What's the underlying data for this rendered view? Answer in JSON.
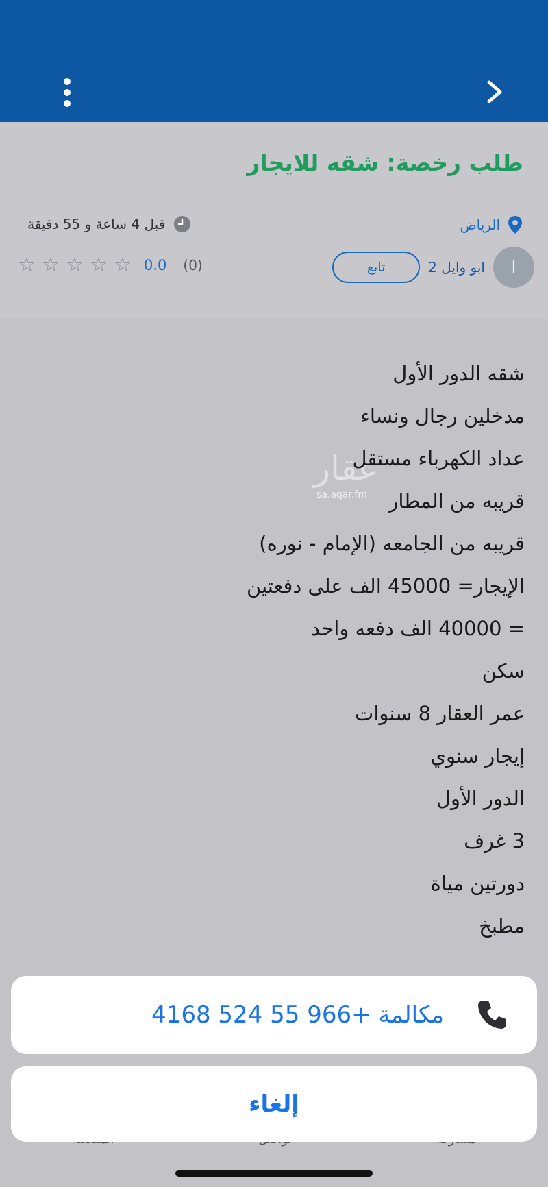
{
  "header": {
    "title": "طلب رخصة: شقه للايجار",
    "location": "الرياض",
    "time_ago": "قبل 4 ساعة و 55 دقيقة"
  },
  "user": {
    "avatar_initial": "ا",
    "name": "ابو وايل 2",
    "follow_label": "تابع",
    "rating_value": "0.0",
    "rating_count": "(0)",
    "stars": [
      "☆",
      "☆",
      "☆",
      "☆",
      "☆"
    ]
  },
  "description": [
    "شقه الدور الأول",
    "مدخلين رجال ونساء",
    "عداد الكهرباء مستقل",
    "قريبه من المطار",
    "قريبه من الجامعه (الإمام - نوره)",
    "الإيجار= 45000 الف على دفعتين",
    "= 40000 الف دفعه واحد",
    "سكن",
    "عمر العقار 8 سنوات",
    "إيجار سنوي",
    "الدور الأول",
    "3 غرف",
    "دورتين مياة",
    "مطبخ"
  ],
  "watermark": {
    "main": "عقار",
    "sub": "sa.aqar.fm"
  },
  "bottom_tabs": [
    "المفضلة",
    "تواصل",
    "مشاركة"
  ],
  "action_sheet": {
    "call_label": "مكالمة +966 55 524 4168",
    "cancel_label": "إلغاء"
  },
  "colors": {
    "topbar": "#0e57a2",
    "title_green": "#1f9c5e",
    "link_blue": "#1a73e8"
  },
  "icons": [
    "back-chevron-icon",
    "more-vertical-icon",
    "location-pin-icon",
    "clock-icon",
    "star-icon",
    "phone-icon"
  ]
}
